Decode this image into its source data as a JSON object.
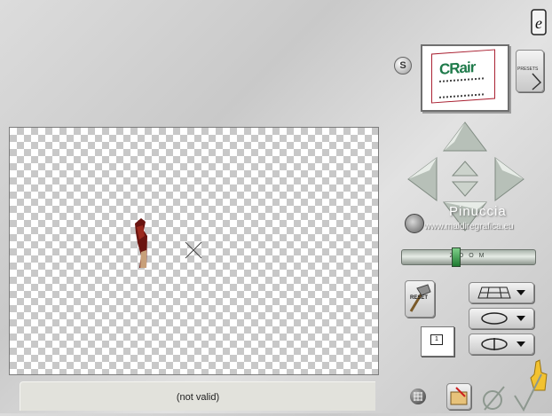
{
  "status": {
    "text": "(not valid)"
  },
  "presets": {
    "label": "PRESETS"
  },
  "reset": {
    "label": "RESET"
  },
  "thumbnail": {
    "title": "CRair"
  },
  "s_button": {
    "label": "S"
  },
  "watermark": {
    "name": "Pinuccia",
    "url": "www.maldiregrafica.eu"
  },
  "zoom": {
    "label": "Z O O M",
    "level": 0.4
  },
  "counter": {
    "value": "1"
  },
  "icons": [
    "e-logo-icon",
    "arrow-up-icon",
    "arrow-down-icon",
    "arrow-left-icon",
    "arrow-right-icon",
    "move-up-icon",
    "move-down-icon",
    "rotate-icon",
    "perspective-grid-icon",
    "ellipse-icon",
    "flip-icon",
    "grid-icon",
    "open-folder-icon",
    "cancel-icon",
    "ok-check-icon",
    "help-hand-icon",
    "hammer-icon"
  ]
}
